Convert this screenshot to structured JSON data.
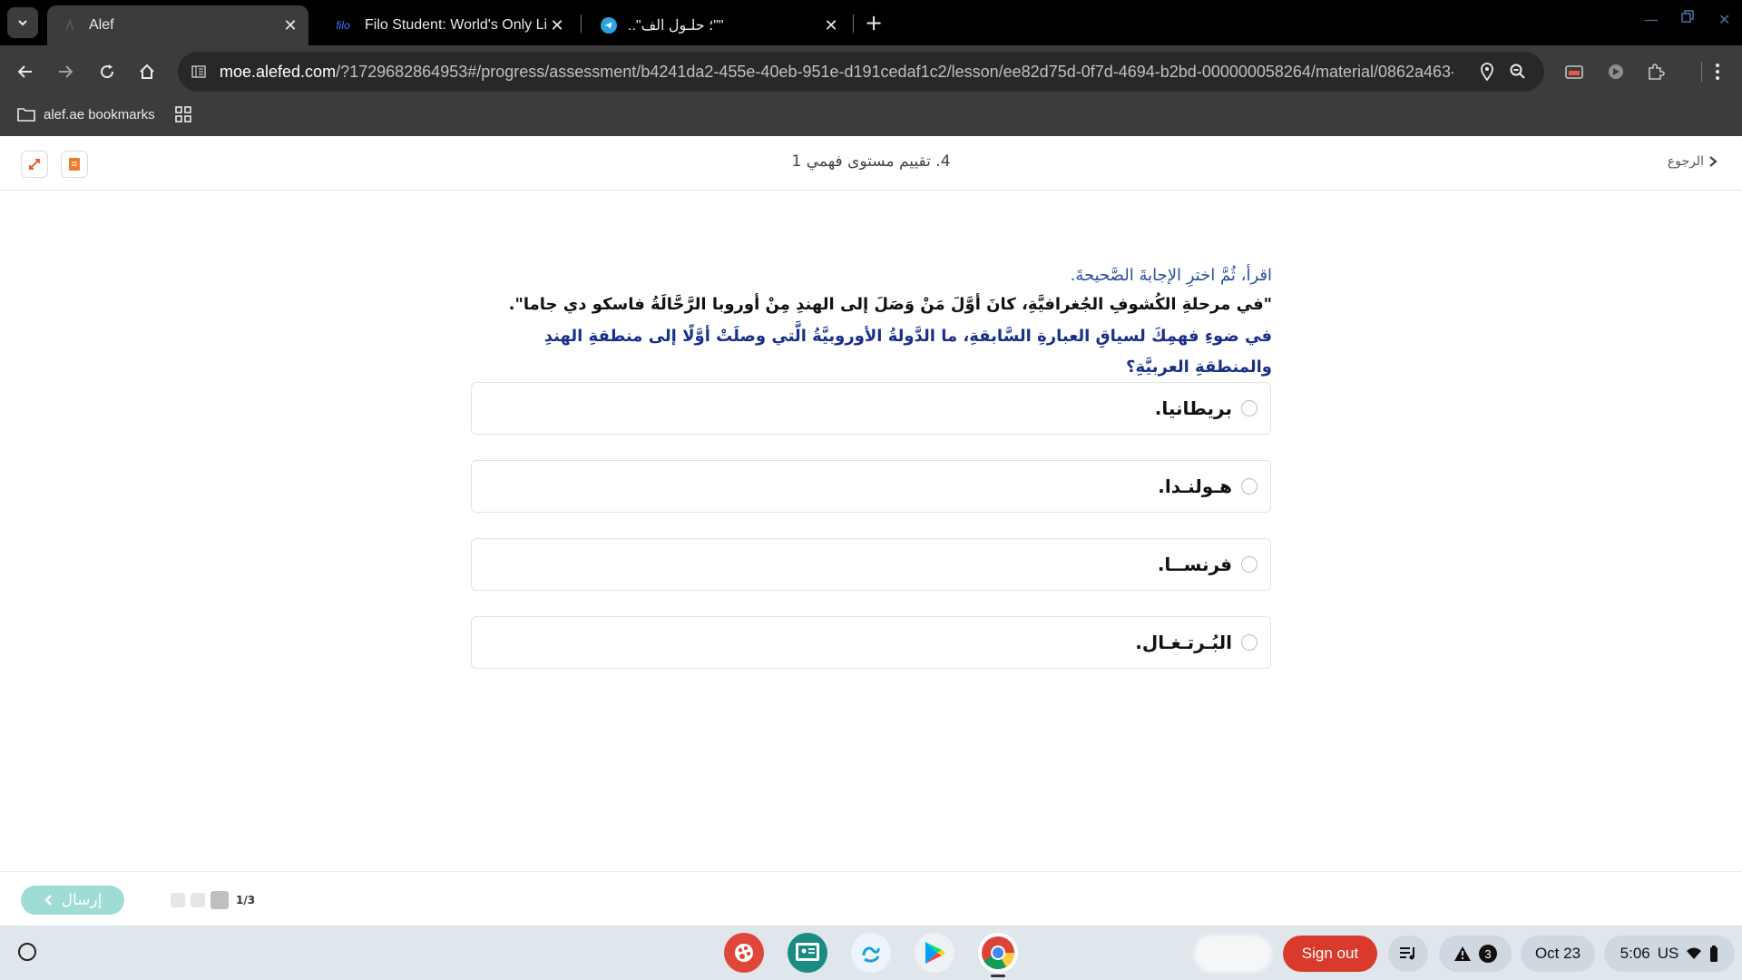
{
  "browser": {
    "tabs": [
      {
        "title": "Alef",
        "active": true
      },
      {
        "title": "Filo Student: World's Only Live I",
        "favicon_text": "filo",
        "active": false
      },
      {
        "title": "\"\"؛ حلـول الف\"..",
        "active": false
      }
    ],
    "url_host": "moe.alefed.com",
    "url_path": "/?1729682864953#/progress/assessment/b4241da2-455e-40eb-951e-d191cedaf1c2/lesson/ee82d75d-0f7d-4694-b2bd-000000058264/material/0862a463-...",
    "bookmarks": [
      {
        "label": "alef.ae bookmarks"
      }
    ]
  },
  "header": {
    "title": "4. تقييم مستوى فهمي 1",
    "back_label": "الرجوع"
  },
  "question": {
    "instruction": "اقرأ، ثُمَّ اخترِ الإجابةَ الصَّحيحةَ.",
    "quote": "\"في مرحلةِ الكُشوفِ الجُغرافيَّةِ، كانَ أوَّلَ مَنْ وَصَلَ إلى الهندِ مِنْ أوروبا الرَّحَّالَةُ فاسكو دي جاما\".",
    "prompt": "في ضوءِ فهمِكَ لسياقِ العبارةِ السَّابقةِ، ما الدَّولةُ الأوروبيَّةُ الَّتي وصلَتْ أوَّلًا إلى منطقةِ الهندِ والمنطقةِ العربيَّةِ؟",
    "options": [
      {
        "label": "بريطانيا."
      },
      {
        "label": "هـولنـدا."
      },
      {
        "label": "فرنســا."
      },
      {
        "label": "البُـرتـغـال."
      }
    ]
  },
  "footer": {
    "submit_label": "إرسال",
    "progress_text": "1/3",
    "current_page": 1,
    "total_pages": 3
  },
  "shelf": {
    "signout_label": "Sign out",
    "notification_count": "3",
    "date": "Oct 23",
    "time": "5:06",
    "locale": "US"
  },
  "colors": {
    "accent_submit": "#9edcd4",
    "signout": "#d93a2b",
    "question_blue": "#1a2f8a"
  }
}
